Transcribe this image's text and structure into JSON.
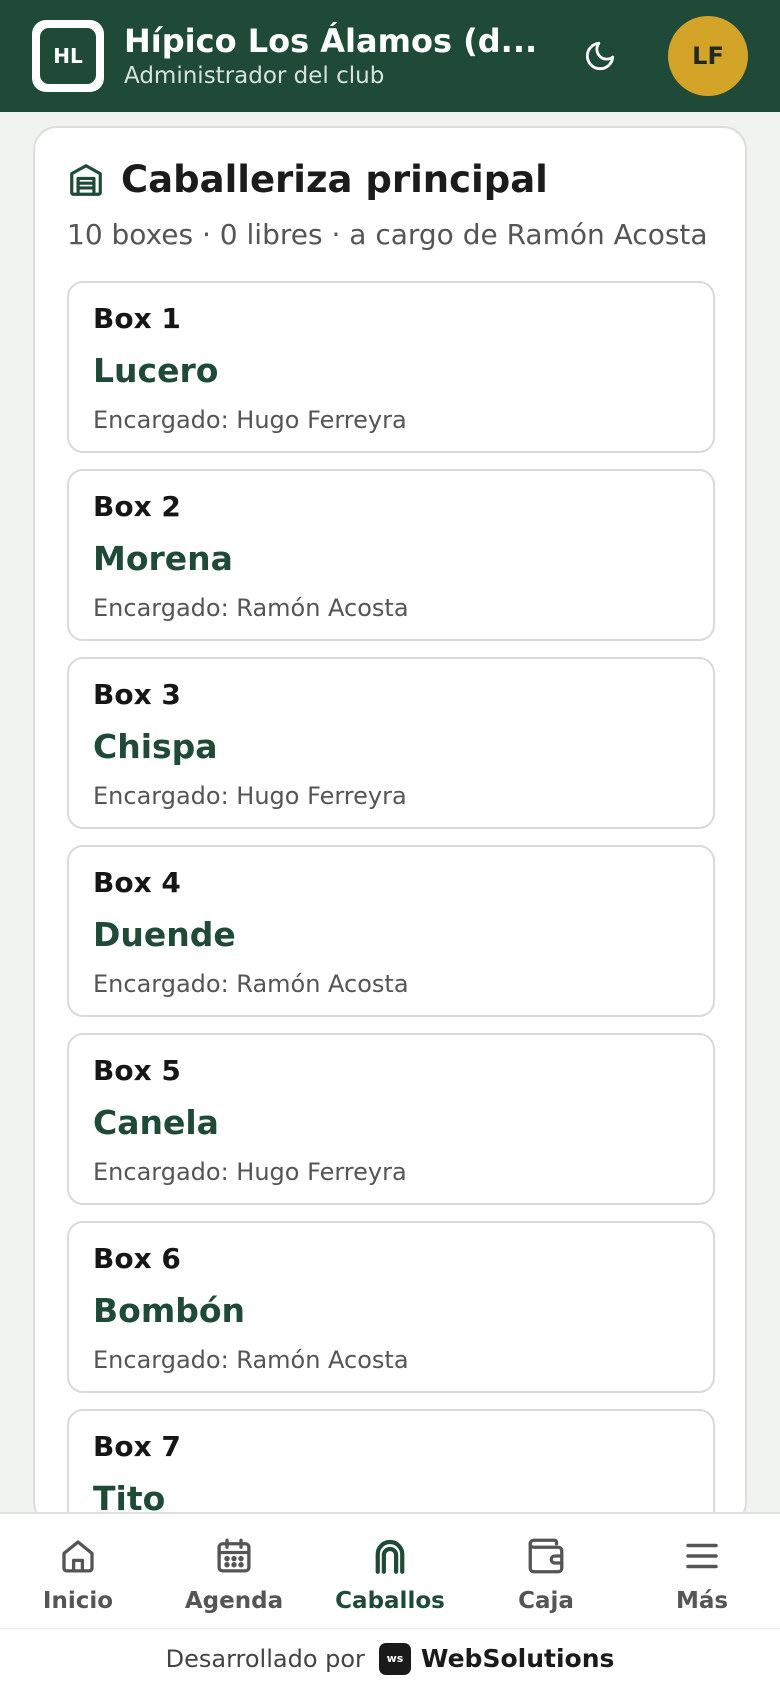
{
  "header": {
    "logo_initials": "HL",
    "title": "Hípico Los Álamos (d...",
    "subtitle": "Administrador del club",
    "avatar_initials": "LF"
  },
  "stable": {
    "title": "Caballeriza principal",
    "summary": "10 boxes · 0 libres · a cargo de Ramón Acosta",
    "boxes": [
      {
        "label": "Box 1",
        "horse": "Lucero",
        "caretaker": "Encargado: Hugo Ferreyra"
      },
      {
        "label": "Box 2",
        "horse": "Morena",
        "caretaker": "Encargado: Ramón Acosta"
      },
      {
        "label": "Box 3",
        "horse": "Chispa",
        "caretaker": "Encargado: Hugo Ferreyra"
      },
      {
        "label": "Box 4",
        "horse": "Duende",
        "caretaker": "Encargado: Ramón Acosta"
      },
      {
        "label": "Box 5",
        "horse": "Canela",
        "caretaker": "Encargado: Hugo Ferreyra"
      },
      {
        "label": "Box 6",
        "horse": "Bombón",
        "caretaker": "Encargado: Ramón Acosta"
      },
      {
        "label": "Box 7",
        "horse": "Tito",
        "caretaker": ""
      }
    ]
  },
  "nav": {
    "items": [
      {
        "label": "Inicio",
        "icon": "home-icon"
      },
      {
        "label": "Agenda",
        "icon": "calendar-icon"
      },
      {
        "label": "Caballos",
        "icon": "horseshoe-icon",
        "active": true
      },
      {
        "label": "Caja",
        "icon": "wallet-icon"
      },
      {
        "label": "Más",
        "icon": "menu-icon"
      }
    ]
  },
  "footer": {
    "prefix": "Desarrollado por",
    "badge": "ws",
    "brand": "WebSolutions"
  },
  "colors": {
    "brand_green": "#1f4a38",
    "avatar_gold": "#d4a429",
    "background": "#f1f3f1"
  }
}
